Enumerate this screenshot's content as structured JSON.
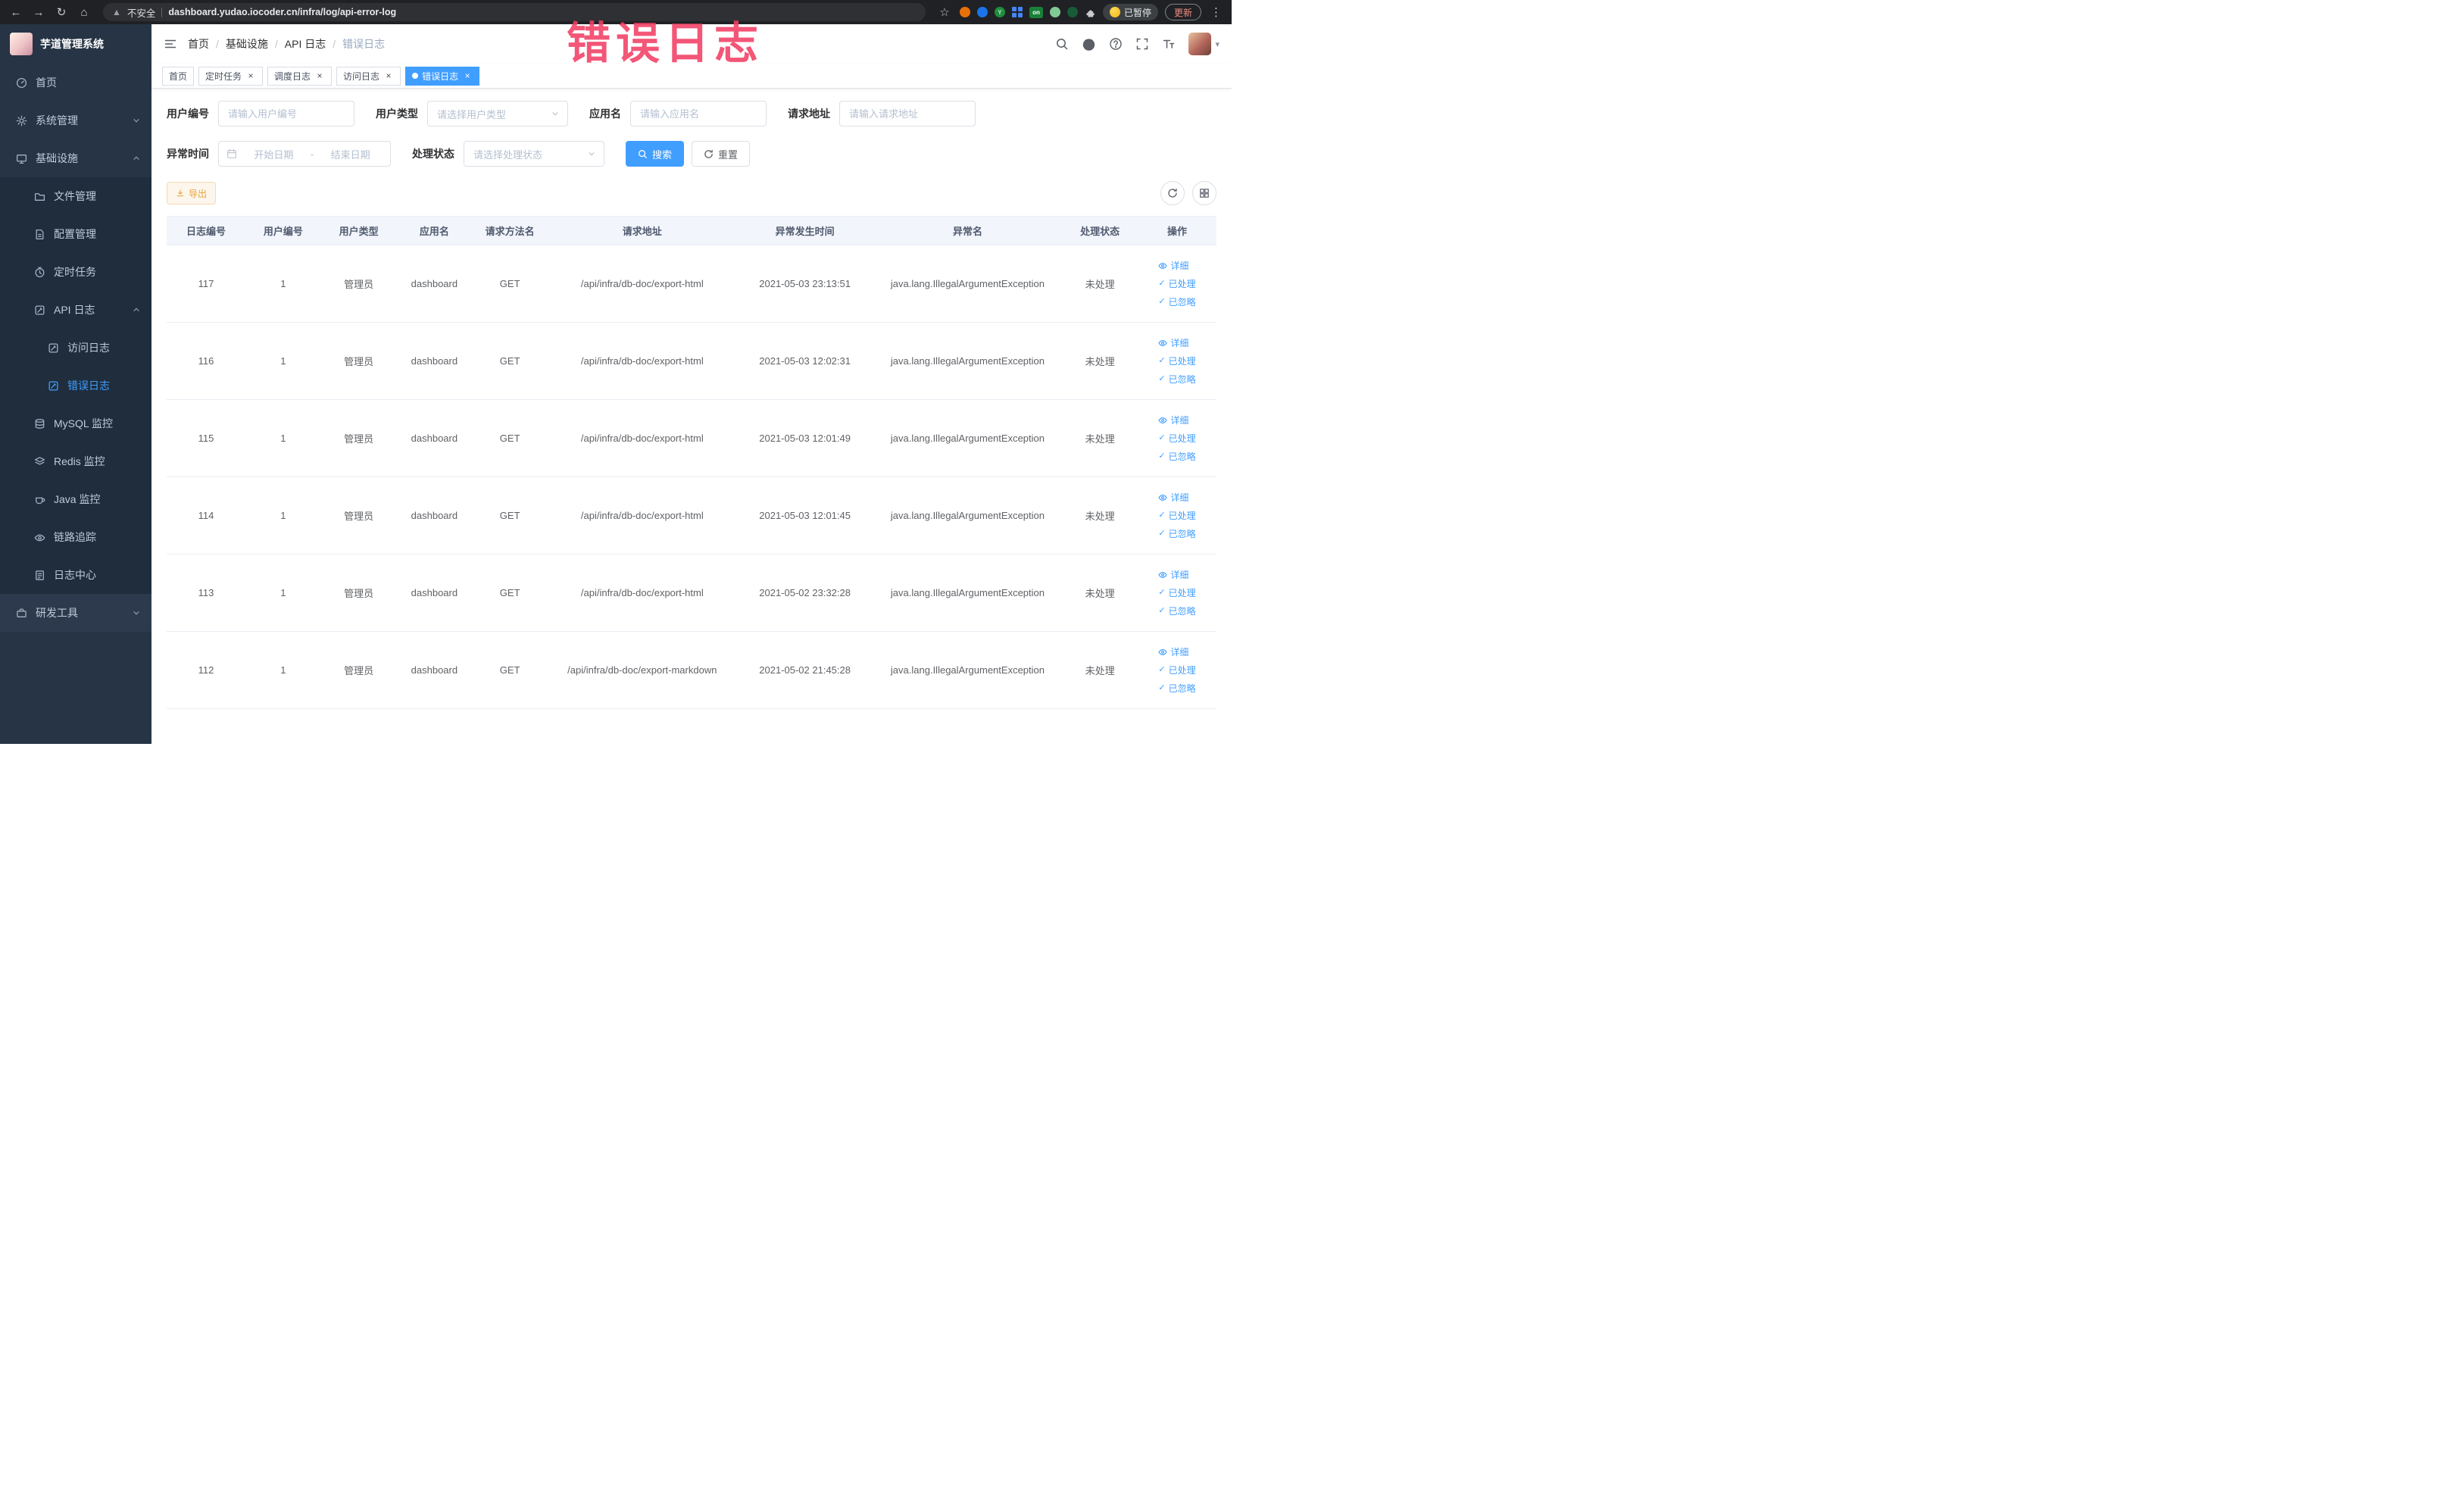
{
  "colors": {
    "accent": "#409eff",
    "warning": "#e6a23c",
    "overlay_pink": "#f13f64",
    "sidebar_bg": "#263445",
    "submenu_bg": "#1f2d3d",
    "table_header_bg": "#f2f6fc"
  },
  "browser": {
    "security_label": "不安全",
    "url": "dashboard.yudao.iocoder.cn/infra/log/api-error-log",
    "paused_button": "已暂停",
    "update_button": "更新",
    "on_badge": "on"
  },
  "overlay_title": "错误日志",
  "sidebar": {
    "logo_title": "芋道管理系统",
    "items": {
      "home": "首页",
      "system": "系统管理",
      "infra": "基础设施",
      "file": "文件管理",
      "config": "配置管理",
      "job": "定时任务",
      "api_log": "API 日志",
      "access_log": "访问日志",
      "error_log": "错误日志",
      "mysql": "MySQL 监控",
      "redis": "Redis 监控",
      "java": "Java 监控",
      "trace": "链路追踪",
      "log_center": "日志中心",
      "dev_tools": "研发工具"
    }
  },
  "breadcrumb": [
    "首页",
    "基础设施",
    "API 日志",
    "错误日志"
  ],
  "breadcrumb_separator": "/",
  "tags": [
    "首页",
    "定时任务",
    "调度日志",
    "访问日志",
    "错误日志"
  ],
  "filters": {
    "user_id": {
      "label": "用户编号",
      "placeholder": "请输入用户编号"
    },
    "user_type": {
      "label": "用户类型",
      "placeholder": "请选择用户类型"
    },
    "app_name": {
      "label": "应用名",
      "placeholder": "请输入应用名"
    },
    "request_url": {
      "label": "请求地址",
      "placeholder": "请输入请求地址"
    },
    "exception_time": {
      "label": "异常时间",
      "start_placeholder": "开始日期",
      "separator": "-",
      "end_placeholder": "结束日期"
    },
    "process_status": {
      "label": "处理状态",
      "placeholder": "请选择处理状态"
    },
    "search_button": "搜索",
    "reset_button": "重置"
  },
  "toolbar": {
    "export_button": "导出"
  },
  "table": {
    "headers": [
      "日志编号",
      "用户编号",
      "用户类型",
      "应用名",
      "请求方法名",
      "请求地址",
      "异常发生时间",
      "异常名",
      "处理状态",
      "操作"
    ],
    "actions": {
      "detail": "详细",
      "processed": "已处理",
      "ignored": "已忽略"
    },
    "rows": [
      {
        "id": "117",
        "user_id": "1",
        "user_type": "管理员",
        "app": "dashboard",
        "method": "GET",
        "url": "/api/infra/db-doc/export-html",
        "time": "2021-05-03 23:13:51",
        "exception": "java.lang.IllegalArgumentException",
        "status": "未处理"
      },
      {
        "id": "116",
        "user_id": "1",
        "user_type": "管理员",
        "app": "dashboard",
        "method": "GET",
        "url": "/api/infra/db-doc/export-html",
        "time": "2021-05-03 12:02:31",
        "exception": "java.lang.IllegalArgumentException",
        "status": "未处理"
      },
      {
        "id": "115",
        "user_id": "1",
        "user_type": "管理员",
        "app": "dashboard",
        "method": "GET",
        "url": "/api/infra/db-doc/export-html",
        "time": "2021-05-03 12:01:49",
        "exception": "java.lang.IllegalArgumentException",
        "status": "未处理"
      },
      {
        "id": "114",
        "user_id": "1",
        "user_type": "管理员",
        "app": "dashboard",
        "method": "GET",
        "url": "/api/infra/db-doc/export-html",
        "time": "2021-05-03 12:01:45",
        "exception": "java.lang.IllegalArgumentException",
        "status": "未处理"
      },
      {
        "id": "113",
        "user_id": "1",
        "user_type": "管理员",
        "app": "dashboard",
        "method": "GET",
        "url": "/api/infra/db-doc/export-html",
        "time": "2021-05-02 23:32:28",
        "exception": "java.lang.IllegalArgumentException",
        "status": "未处理"
      },
      {
        "id": "112",
        "user_id": "1",
        "user_type": "管理员",
        "app": "dashboard",
        "method": "GET",
        "url": "/api/infra/db-doc/export-markdown",
        "time": "2021-05-02 21:45:28",
        "exception": "java.lang.IllegalArgumentException",
        "status": "未处理"
      }
    ]
  }
}
